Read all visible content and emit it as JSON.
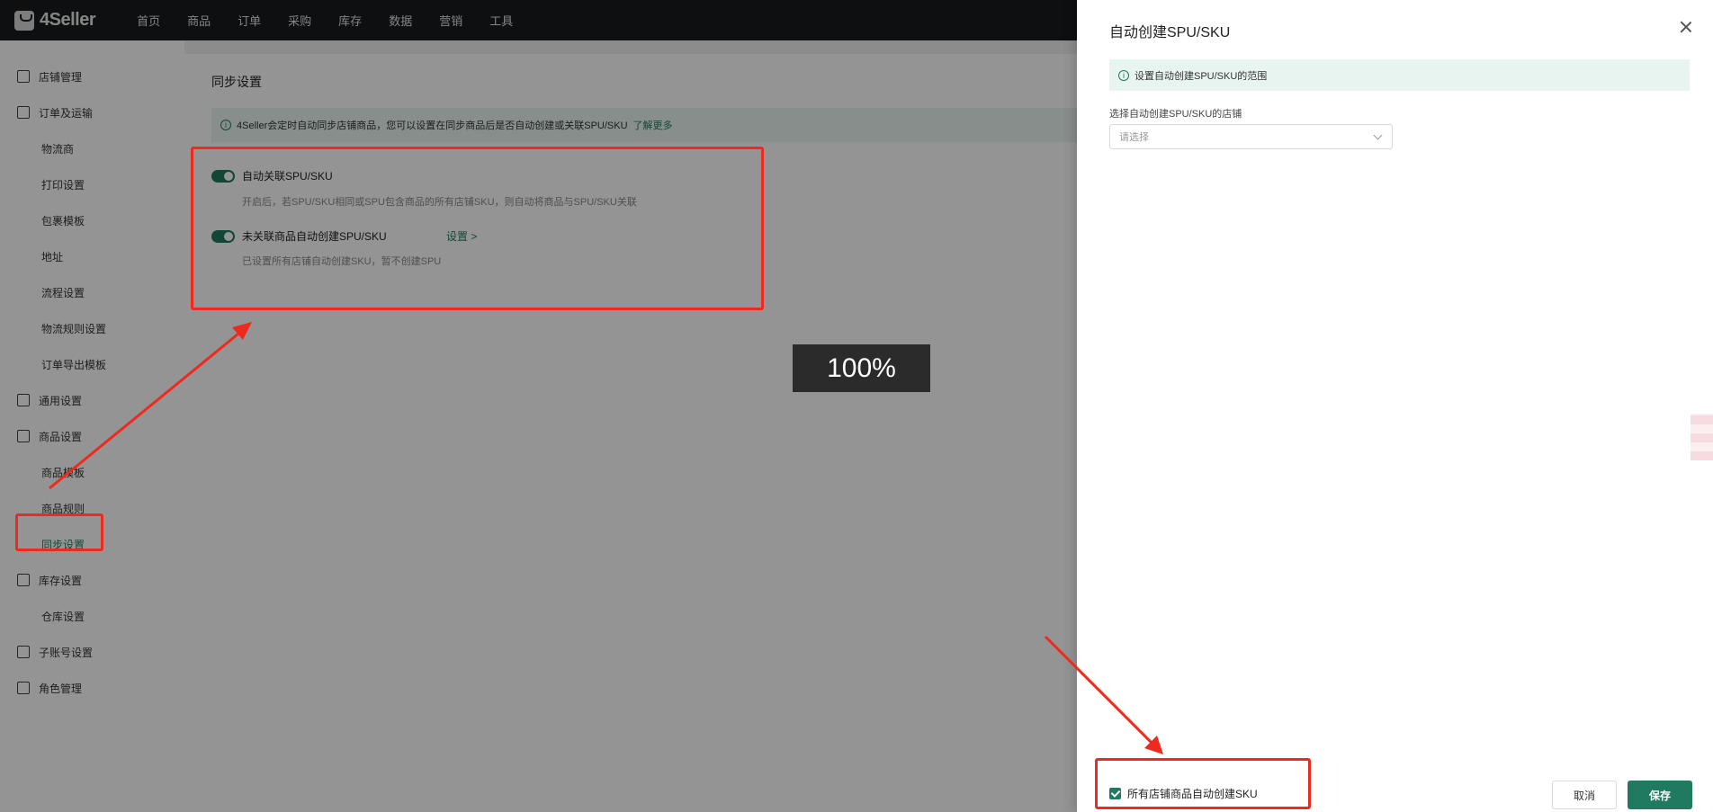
{
  "app": {
    "logo_text": "4Seller"
  },
  "nav": [
    "首页",
    "商品",
    "订单",
    "采购",
    "库存",
    "数据",
    "营销",
    "工具"
  ],
  "sidebar": {
    "items": [
      {
        "label": "店铺管理",
        "type": "group"
      },
      {
        "label": "订单及运输",
        "type": "group"
      },
      {
        "label": "物流商",
        "type": "sub"
      },
      {
        "label": "打印设置",
        "type": "sub"
      },
      {
        "label": "包裹模板",
        "type": "sub"
      },
      {
        "label": "地址",
        "type": "sub"
      },
      {
        "label": "流程设置",
        "type": "sub"
      },
      {
        "label": "物流规则设置",
        "type": "sub"
      },
      {
        "label": "订单导出模板",
        "type": "sub"
      },
      {
        "label": "通用设置",
        "type": "group"
      },
      {
        "label": "商品设置",
        "type": "group"
      },
      {
        "label": "商品模板",
        "type": "sub"
      },
      {
        "label": "商品规则",
        "type": "sub"
      },
      {
        "label": "同步设置",
        "type": "sub",
        "active": true
      },
      {
        "label": "库存设置",
        "type": "group"
      },
      {
        "label": "仓库设置",
        "type": "sub"
      },
      {
        "label": "子账号设置",
        "type": "group"
      },
      {
        "label": "角色管理",
        "type": "group"
      }
    ]
  },
  "main": {
    "title": "同步设置",
    "notice": "4Seller会定时自动同步店铺商品，您可以设置在同步商品后是否自动创建或关联SPU/SKU",
    "notice_link": "了解更多",
    "settings": [
      {
        "label": "自动关联SPU/SKU",
        "enabled": true,
        "desc": "开启后，若SPU/SKU相同或SPU包含商品的所有店铺SKU，则自动将商品与SPU/SKU关联"
      },
      {
        "label": "未关联商品自动创建SPU/SKU",
        "enabled": true,
        "desc": "已设置所有店铺自动创建SKU，暂不创建SPU",
        "link": "设置 >"
      }
    ]
  },
  "zoom_indicator": "100%",
  "drawer": {
    "title": "自动创建SPU/SKU",
    "notice": "设置自动创建SPU/SKU的范围",
    "field_label": "选择自动创建SPU/SKU的店铺",
    "select_placeholder": "请选择",
    "checkbox_label": "所有店铺商品自动创建SKU",
    "checkbox_checked": true,
    "cancel_label": "取消",
    "save_label": "保存"
  },
  "colors": {
    "accent": "#1f7a60",
    "annotation": "#ee2a1f",
    "topbar": "#171a1d"
  }
}
